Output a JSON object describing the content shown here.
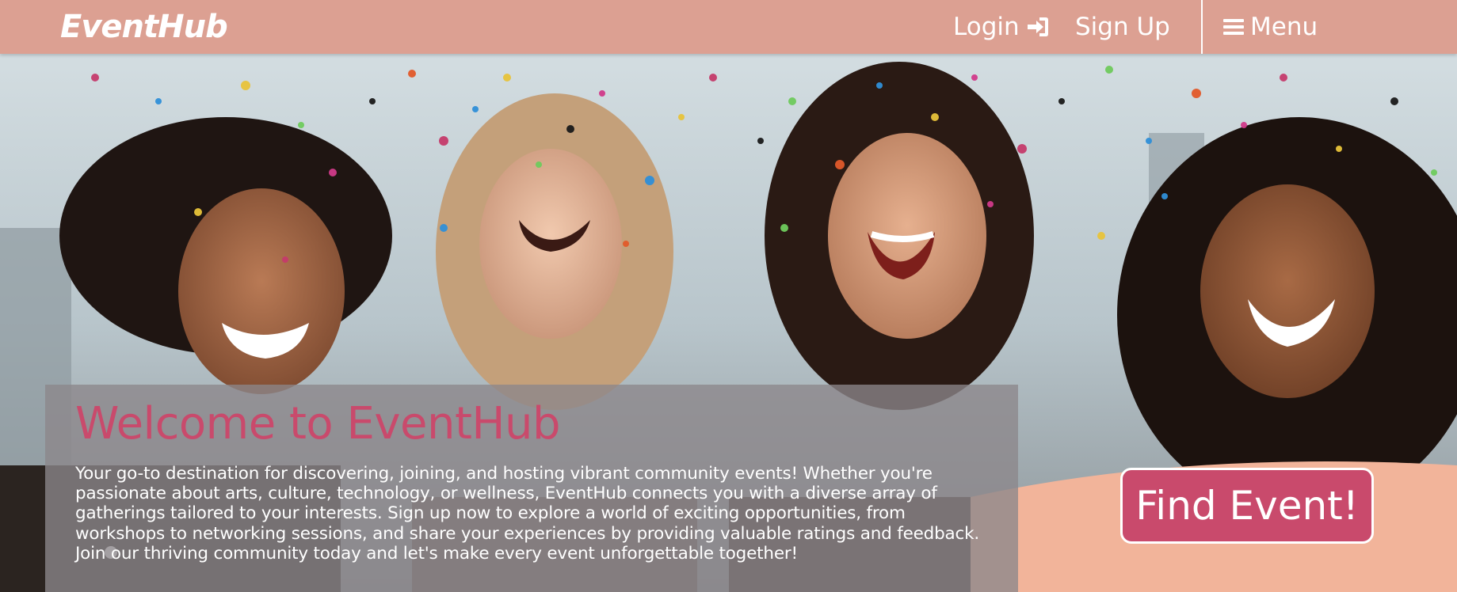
{
  "navbar": {
    "brand": "EventHub",
    "login_label": "Login",
    "login_icon": "sign-in-icon",
    "signup_label": "Sign Up",
    "menu_label": "Menu",
    "menu_icon": "hamburger-icon"
  },
  "hero": {
    "image": "hero-photo-friends-confetti",
    "title": "Welcome to EventHub",
    "description": "Your go-to destination for discovering, joining, and hosting vibrant community events! Whether you're passionate about arts, culture, technology, or wellness, EventHub connects you with a diverse array of gatherings tailored to your interests. Sign up now to explore a world of exciting opportunities, from workshops to networking sessions, and share your experiences by providing valuable ratings and feedback. Join our thriving community today and let's make every event unforgettable together!",
    "cta_label": "Find Event!"
  },
  "colors": {
    "navbar_bg": "#dca092",
    "accent": "#c94a6c",
    "text_light": "#ffffff",
    "panel_bg": "rgba(140,135,138,0.78)"
  }
}
